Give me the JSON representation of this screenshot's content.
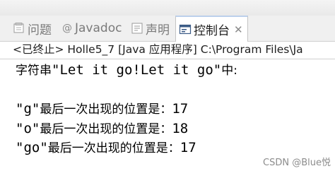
{
  "tabs": [
    {
      "label": "问题",
      "icon": "problems-icon"
    },
    {
      "label": "Javadoc",
      "icon": "at-icon"
    },
    {
      "label": "声明",
      "icon": "declaration-icon"
    },
    {
      "label": "控制台",
      "icon": "console-icon",
      "active": true
    }
  ],
  "tab_close": "✕",
  "status": "<已终止> Holle5_7 [Java 应用程序] C:\\Program Files\\Ja",
  "console": {
    "line1": {
      "prefix": "字符串",
      "quoted": "\"Let it go!Let it go\"",
      "suffix": "中:"
    },
    "results": [
      {
        "key": "\"g\"",
        "text": "最后一次出现的位置是：",
        "value": "17"
      },
      {
        "key": "\"o\"",
        "text": "最后一次出现的位置是：",
        "value": "18"
      },
      {
        "key": "\"go\"",
        "text": "最后一次出现的位置是：",
        "value": "17"
      }
    ]
  },
  "watermark": "CSDN @Blue悦"
}
